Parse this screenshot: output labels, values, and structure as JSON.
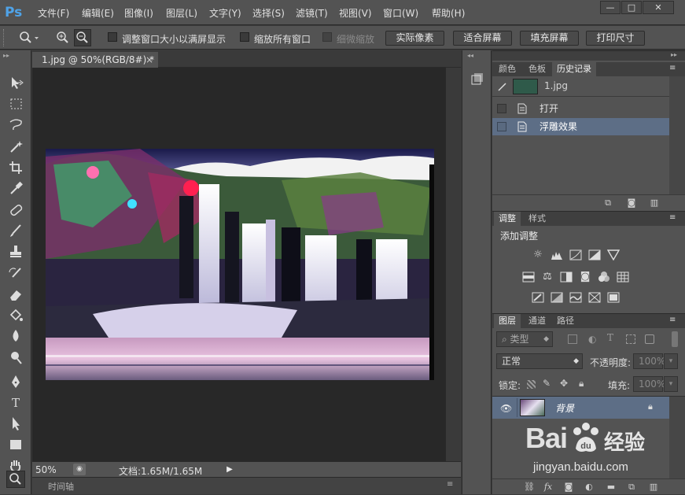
{
  "app": {
    "logo": "Ps"
  },
  "menu": [
    "文件(F)",
    "编辑(E)",
    "图像(I)",
    "图层(L)",
    "文字(Y)",
    "选择(S)",
    "滤镜(T)",
    "视图(V)",
    "窗口(W)",
    "帮助(H)"
  ],
  "window_controls": {
    "minimize": "—",
    "maximize": "□",
    "close": "✕"
  },
  "options": {
    "resize_windows": "调整窗口大小以满屏显示",
    "zoom_all": "缩放所有窗口",
    "scrubby": "细微缩放",
    "actual_pixels": "实际像素",
    "fit_screen": "适合屏幕",
    "fill_screen": "填充屏幕",
    "print_size": "打印尺寸"
  },
  "document": {
    "tab_title": "1.jpg @ 50%(RGB/8#) *",
    "tab_close": "×",
    "zoom": "50%",
    "doc_size": "文档:1.65M/1.65M",
    "timeline": "时间轴"
  },
  "history_panel": {
    "tabs": [
      "颜色",
      "色板",
      "历史记录"
    ],
    "active_tab": 2,
    "snapshot": "1.jpg",
    "items": [
      "打开",
      "浮雕效果"
    ],
    "selected_index": 1
  },
  "adjust_panel": {
    "tabs": [
      "调整",
      "样式"
    ],
    "title": "添加调整"
  },
  "layers_panel": {
    "tabs": [
      "图层",
      "通道",
      "路径"
    ],
    "filter_kind": "类型",
    "blend_mode": "正常",
    "opacity_label": "不透明度:",
    "opacity_value": "100%",
    "lock_label": "锁定:",
    "fill_label": "填充:",
    "fill_value": "100%",
    "layer_name": "背景"
  },
  "watermark": {
    "brand": "Bai",
    "cn": "经验",
    "url": "jingyan.baidu.com"
  },
  "colors": {
    "chrome": "#535353",
    "canvas_bg": "#282828",
    "selection": "#5d6e86",
    "ps_blue": "#4fa3e8"
  }
}
